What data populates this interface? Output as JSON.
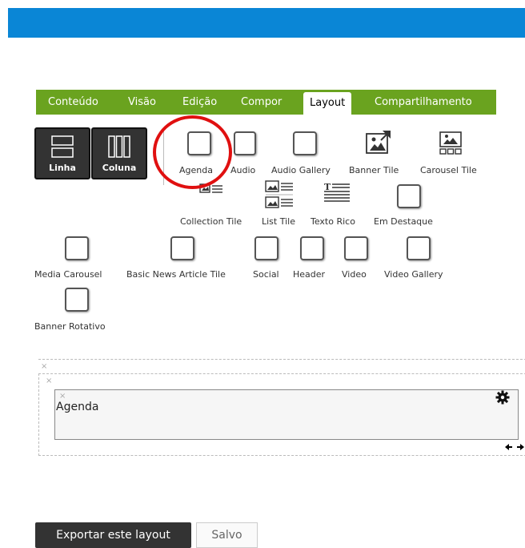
{
  "tabs": [
    {
      "label": "Conteúdo"
    },
    {
      "label": "Visão"
    },
    {
      "label": "Edição"
    },
    {
      "label": "Compor"
    },
    {
      "label": "Layout",
      "active": true
    },
    {
      "label": "Compartilhamento"
    }
  ],
  "layout_buttons": {
    "row": "Linha",
    "column": "Coluna"
  },
  "tiles": {
    "agenda": "Agenda",
    "audio": "Audio",
    "audio_gallery": "Audio Gallery",
    "banner_tile": "Banner Tile",
    "carousel_tile": "Carousel Tile",
    "collection_tile": "Collection Tile",
    "list_tile": "List Tile",
    "texto_rico": "Texto Rico",
    "em_destaque": "Em Destaque",
    "media_carousel": "Media Carousel",
    "basic_news_article_tile": "Basic News Article Tile",
    "social": "Social",
    "header": "Header",
    "video": "Video",
    "video_gallery": "Video Gallery",
    "banner_rotativo": "Banner Rotativo"
  },
  "canvas": {
    "tile_title": "Agenda",
    "remove_mark": "×"
  },
  "footer": {
    "export": "Exportar este layout",
    "saved": "Salvo"
  },
  "colors": {
    "topbar": "#0a86d6",
    "tabs": "#6aa31f",
    "highlight": "#e01010"
  }
}
